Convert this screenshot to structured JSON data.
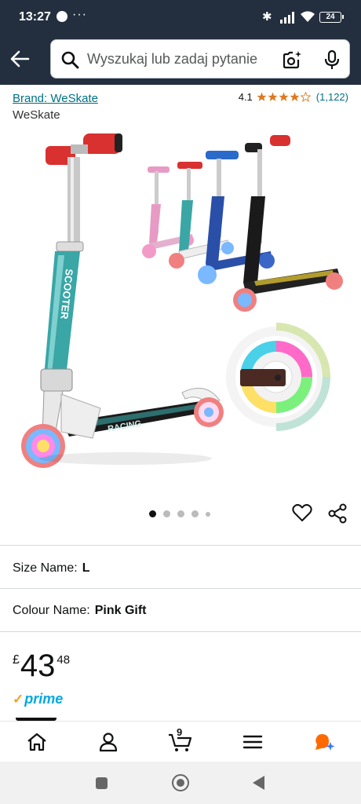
{
  "status_bar": {
    "time": "13:27",
    "dots": "···",
    "battery": "24"
  },
  "search": {
    "placeholder": "Wyszukaj lub zadaj pytanie"
  },
  "product": {
    "brand_link": "Brand: WeSkate",
    "brand_name": "WeSkate",
    "rating_value": "4.1",
    "rating_stars": 4.1,
    "rating_count": "(1,122)",
    "image_count": 5,
    "active_image": 1,
    "image_text": {
      "scooter_stem": "SCOOTER",
      "deck": "RACING"
    },
    "size_label": "Size Name:",
    "size_value": "L",
    "colour_label": "Colour Name:",
    "colour_value": "Pink Gift",
    "price_currency": "£",
    "price_whole": "43",
    "price_fraction": "48",
    "prime_label": "prime"
  },
  "bottom_nav": {
    "items": [
      "home",
      "account",
      "cart",
      "menu",
      "rufus"
    ],
    "cart_count": "9"
  },
  "colors": {
    "header_bg": "#232f3e",
    "link": "#007185",
    "star": "#de7921",
    "prime_blue": "#00a8e1"
  }
}
